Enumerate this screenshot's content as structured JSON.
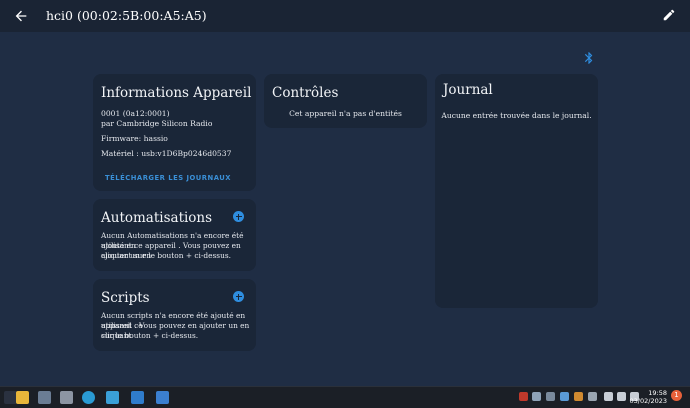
{
  "header": {
    "title": "hci0 (00:02:5B:00:A5:A5)"
  },
  "info_card": {
    "title": "Informations Appareil",
    "model": "0001 (0a12:0001)",
    "manufacturer": "par Cambridge Silicon Radio",
    "firmware": "Firmware: hassio",
    "hardware": "Matériel : usb:v1D6Bp0246d0537",
    "download_label": "TÉLÉCHARGER LES JOURNAUX"
  },
  "controls_card": {
    "title": "Contrôles",
    "empty": "Cet appareil n'a pas d'entités"
  },
  "journal_card": {
    "title": "Journal",
    "empty": "Aucune entrée trouvée dans le journal."
  },
  "automations_card": {
    "title": "Automatisations",
    "line1": "Aucun Automatisations n'a encore été ajouté en",
    "line2": "utilisant ce appareil . Vous pouvez en ajouter un en",
    "line3": "cliquant sur le bouton + ci-dessus."
  },
  "scripts_card": {
    "title": "Scripts",
    "line1": "Aucun scripts n'a encore été ajouté en utilisant ce",
    "line2": "appareil . Vous pouvez en ajouter un en cliquant",
    "line3": "sur le bouton + ci-dessus."
  },
  "taskbar": {
    "time": "19:58",
    "date": "03/02/2023",
    "notifications": "1"
  },
  "icons": {
    "back": "arrow-left-icon",
    "edit": "pencil-icon",
    "bluetooth": "bluetooth-icon",
    "add": "plus-circle-icon"
  },
  "colors": {
    "accent": "#2f8ee0",
    "card": "#1a2638",
    "background": "#1f2d44"
  }
}
